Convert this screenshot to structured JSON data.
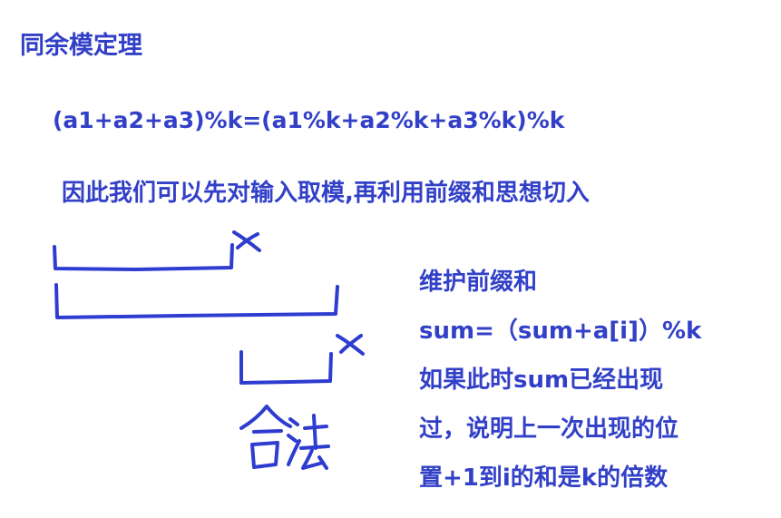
{
  "title": "同余模定理",
  "formula": "(a1+a2+a3)%k=(a1%k+a2%k+a3%k)%k",
  "explanation": "因此我们可以先对输入取模,再利用前缀和思想切入",
  "notes": [
    "维护前缀和",
    "sum=（sum+a[i]）%k",
    "如果此时sum已经出现",
    "过，说明上一次出现的位",
    "置+1到i的和是k的倍数"
  ],
  "sketch": {
    "handwriting": "合法",
    "marks": [
      "x",
      "x"
    ],
    "colors": {
      "ink": "#2e3cd0",
      "text": "#3240c8"
    }
  }
}
